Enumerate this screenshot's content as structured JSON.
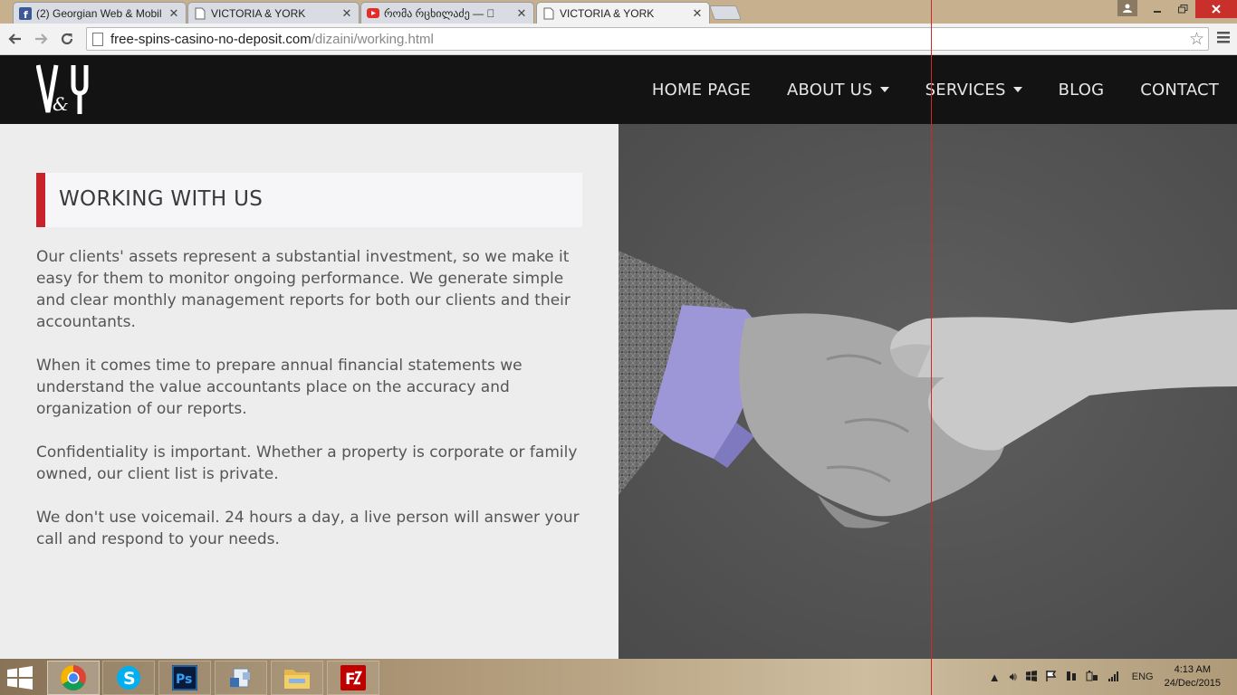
{
  "browser": {
    "tabs": [
      {
        "title": "(2) Georgian Web & Mobil",
        "icon": "facebook-icon"
      },
      {
        "title": "VICTORIA & YORK",
        "icon": "page-icon"
      },
      {
        "title": "რომა რცხილაძე — \u0000",
        "icon": "youtube-icon"
      },
      {
        "title": "VICTORIA & YORK",
        "icon": "page-icon",
        "active": true
      }
    ],
    "close_glyph": "✕",
    "url_host": "free-spins-casino-no-deposit.com",
    "url_path": "/dizaini/working.html"
  },
  "site": {
    "logo_text": "V&Y",
    "nav": [
      {
        "label": "HOME PAGE",
        "dropdown": false
      },
      {
        "label": "ABOUT US",
        "dropdown": true
      },
      {
        "label": "SERVICES",
        "dropdown": true
      },
      {
        "label": "BLOG",
        "dropdown": false
      },
      {
        "label": "CONTACT",
        "dropdown": false
      }
    ],
    "accent_color": "#c8222a",
    "heading": "WORKING WITH US",
    "paragraphs": [
      "Our clients' assets represent a substantial investment, so we make it easy for them to monitor ongoing performance. We generate simple and clear monthly management reports for both our clients and their accountants.",
      "When it comes time to prepare annual financial statements we understand the value accountants place on the accuracy and organization of our reports.",
      "Confidentiality is important. Whether a property is corporate or family owned, our client list is private.",
      "We don't use voicemail. 24 hours a day, a live person will answer your call and respond to your needs."
    ],
    "image": "handshake-photo"
  },
  "taskbar": {
    "apps": [
      "chrome-icon",
      "skype-icon",
      "photoshop-icon",
      "app-icon",
      "file-explorer-icon",
      "filezilla-icon"
    ],
    "language": "ENG",
    "time": "4:13 AM",
    "date": "24/Dec/2015"
  }
}
